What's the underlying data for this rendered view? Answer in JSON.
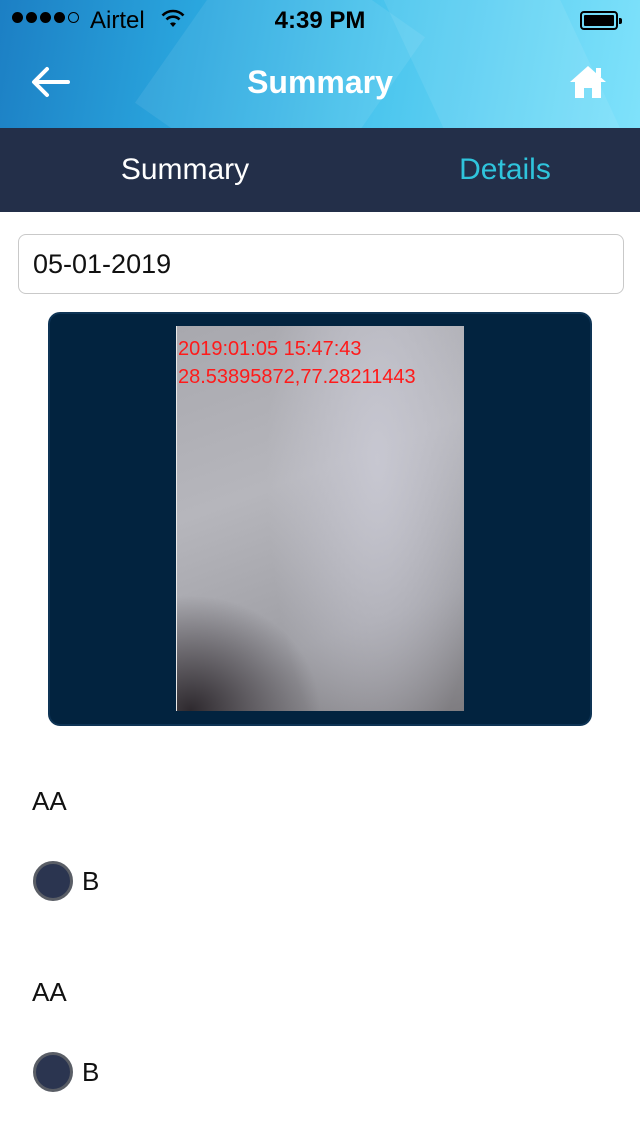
{
  "status_bar": {
    "carrier": "Airtel",
    "time": "4:39 PM",
    "signal_bars_filled": 4,
    "signal_bars_total": 5
  },
  "nav": {
    "title": "Summary",
    "back_icon": "arrow-left-icon",
    "home_icon": "home-icon"
  },
  "tabs": [
    {
      "label": "Summary",
      "active": false
    },
    {
      "label": "Details",
      "active": true
    }
  ],
  "date_field": {
    "value": "05-01-2019"
  },
  "photo": {
    "stamp_datetime": "2019:01:05 15:47:43",
    "stamp_coords": "28.53895872,77.28211443"
  },
  "questions": [
    {
      "label": "AA",
      "option": "B"
    },
    {
      "label": "AA",
      "option": "B"
    }
  ],
  "colors": {
    "tab_bar": "#232f49",
    "active_tab": "#2fc4dc",
    "card_bg": "#02233f",
    "stamp": "#ff1a1a"
  }
}
